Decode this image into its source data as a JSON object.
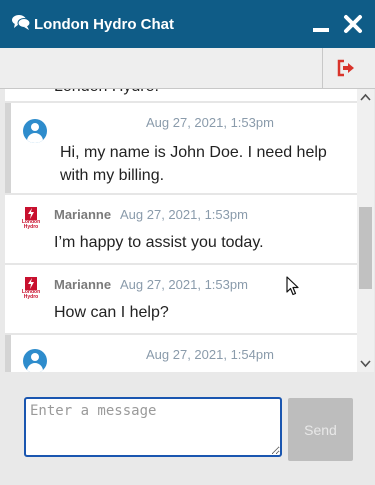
{
  "window": {
    "title": "London Hydro Chat",
    "title_icon": "chat-bubbles-icon",
    "minimize_icon": "minimize-icon",
    "close_icon": "close-icon"
  },
  "toolbar": {
    "logout_icon": "sign-out-icon",
    "accent_color": "#d9342b"
  },
  "messages": [
    {
      "partial_text": "London Hydro."
    },
    {
      "sender": "",
      "avatar": "user-avatar-icon",
      "timestamp": "Aug 27, 2021, 1:53pm",
      "lines": [
        "Hi, my name is John Doe. I need help",
        "with my billing."
      ]
    },
    {
      "sender": "Marianne",
      "avatar": "london-hydro-logo",
      "timestamp": "Aug 27, 2021, 1:53pm",
      "text": "I’m happy to assist you today."
    },
    {
      "sender": "Marianne",
      "avatar": "london-hydro-logo",
      "timestamp": "Aug 27, 2021, 1:53pm",
      "text": "How can I help?"
    },
    {
      "sender": "",
      "avatar": "user-avatar-icon",
      "timestamp": "Aug 27, 2021, 1:54pm"
    }
  ],
  "logo": {
    "line1": "London",
    "line2": "Hydro"
  },
  "composer": {
    "placeholder": "Enter a message",
    "value": "",
    "send_label": "Send"
  },
  "colors": {
    "title_bar": "#0f5c87",
    "brand_red": "#c8102e",
    "timestamp": "#8a9bab"
  }
}
